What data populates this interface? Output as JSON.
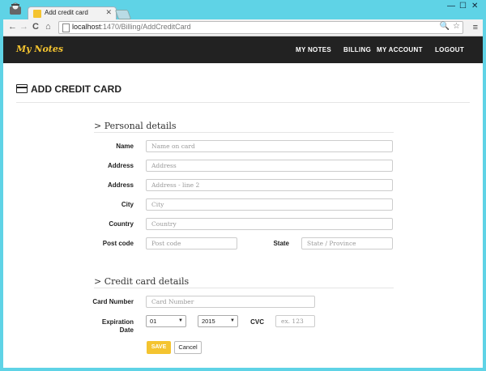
{
  "browser": {
    "tab_title": "Add credit card",
    "tab_close": "✕",
    "url_host": "localhost",
    "url_path": ":1470/Billing/AddCreditCard",
    "minimize": "—",
    "maximize": "☐",
    "close": "✕",
    "back": "←",
    "forward": "→",
    "reload": "C",
    "home": "⌂",
    "zoom": "🔍",
    "star": "☆",
    "menu": "≡"
  },
  "nav": {
    "brand": "My Notes",
    "links": [
      "MY NOTES",
      "BILLING",
      "MY ACCOUNT",
      "LOGOUT"
    ]
  },
  "page": {
    "title": "ADD CREDIT CARD"
  },
  "personal": {
    "heading": "> Personal details",
    "name_label": "Name",
    "name_placeholder": "Name on card",
    "address_label": "Address",
    "address_placeholder": "Address",
    "address2_label": "Address",
    "address2_placeholder": "Address - line 2",
    "city_label": "City",
    "city_placeholder": "City",
    "country_label": "Country",
    "country_placeholder": "Country",
    "postcode_label": "Post code",
    "postcode_placeholder": "Post code",
    "state_label": "State",
    "state_placeholder": "State / Province"
  },
  "card": {
    "heading": "> Credit card details",
    "number_label": "Card Number",
    "number_placeholder": "Card Number",
    "expiration_label_1": "Expiration",
    "expiration_label_2": "Date",
    "month_value": "01",
    "year_value": "2015",
    "cvc_label": "CVC",
    "cvc_placeholder": "ex. 123"
  },
  "actions": {
    "save": "SAVE",
    "cancel": "Cancel"
  }
}
